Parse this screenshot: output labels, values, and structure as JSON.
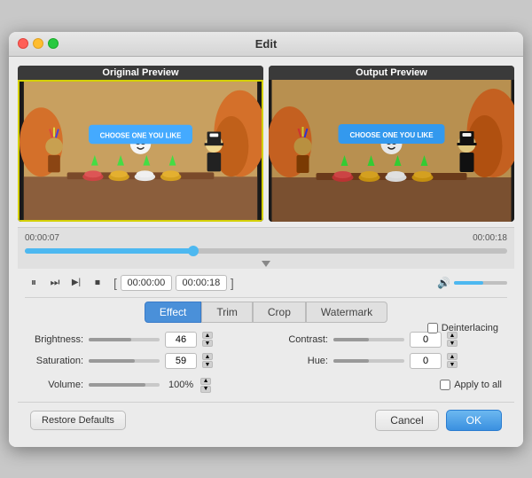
{
  "window": {
    "title": "Edit"
  },
  "previews": {
    "original_label": "Original Preview",
    "output_label": "Output Preview"
  },
  "timeline": {
    "start_time": "00:00:07",
    "end_time": "00:00:18",
    "range_start": "00:00:00",
    "range_end": "00:00:18"
  },
  "tabs": [
    {
      "id": "effect",
      "label": "Effect",
      "active": true
    },
    {
      "id": "trim",
      "label": "Trim",
      "active": false
    },
    {
      "id": "crop",
      "label": "Crop",
      "active": false
    },
    {
      "id": "watermark",
      "label": "Watermark",
      "active": false
    }
  ],
  "settings": {
    "brightness": {
      "label": "Brightness:",
      "value": "46",
      "fill_pct": 60
    },
    "contrast": {
      "label": "Contrast:",
      "value": "0",
      "fill_pct": 50
    },
    "saturation": {
      "label": "Saturation:",
      "value": "59",
      "fill_pct": 65
    },
    "hue": {
      "label": "Hue:",
      "value": "0",
      "fill_pct": 50
    },
    "volume": {
      "label": "Volume:",
      "value": "100%",
      "fill_pct": 80
    }
  },
  "checkboxes": {
    "deinterlacing": {
      "label": "Deinterlacing",
      "checked": false
    },
    "apply_to_all": {
      "label": "Apply to all",
      "checked": false
    }
  },
  "buttons": {
    "restore": "Restore Defaults",
    "cancel": "Cancel",
    "ok": "OK"
  },
  "transport": {
    "pause": "⏸",
    "next": "⏭",
    "skip": "⏩",
    "stop": "⏹"
  }
}
